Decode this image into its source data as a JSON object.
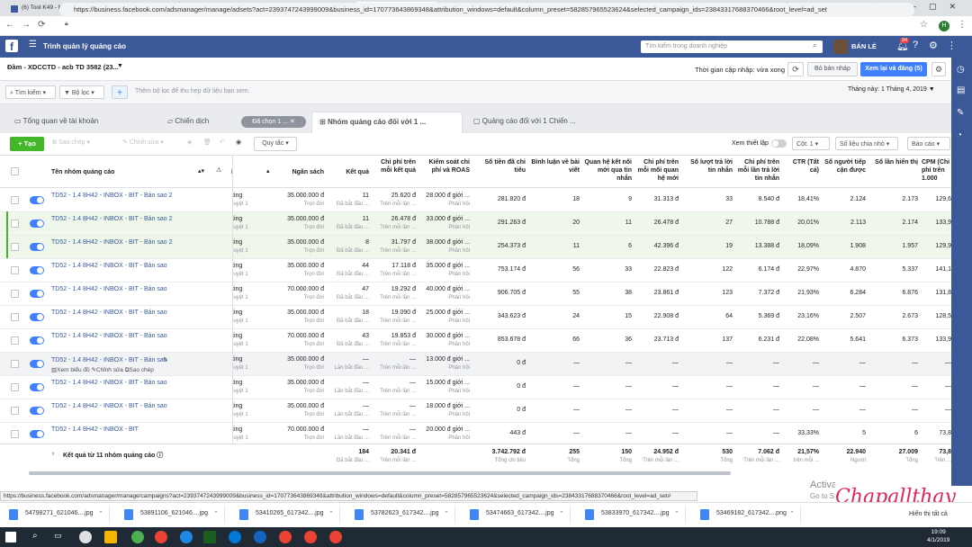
{
  "browser": {
    "tabs": [
      {
        "label": "(6) Tool K49 - Nuô",
        "icon": "facebook-icon",
        "color": "#3b5998"
      },
      {
        "label": "Video Giới thiệu cả",
        "icon": "youtube-icon",
        "color": "#ff0000"
      },
      {
        "label": "(6) Tool K49 - Nuô",
        "icon": "facebook-icon",
        "color": "#3b5998"
      },
      {
        "label": "(3) Trình quản lý q",
        "icon": "ads-manager-icon",
        "color": "#606770"
      },
      {
        "label": "(94) Trình quản lý q",
        "icon": "ads-manager-icon",
        "color": "#606770",
        "active": true
      },
      {
        "label": "ADS TỔNG - HUYỀ",
        "icon": "sheets-icon",
        "color": "#0f9d58"
      },
      {
        "label": "HDBank Internet B",
        "icon": "bank-icon",
        "color": "#f4b400"
      },
      {
        "label": "Drive của tôi - Goo",
        "icon": "drive-icon",
        "color": "#1a73e8"
      },
      {
        "label": "TMDT - BẢN SAN T",
        "icon": "sheets-icon",
        "color": "#0f9d58"
      },
      {
        "label": "Pancake v2 | Pages",
        "icon": "pancake-icon",
        "color": "#9e9e9e"
      }
    ],
    "url": "https://business.facebook.com/adsmanager/manage/adsets?act=2393747243999009&business_id=170773643869348&attribution_windows=default&column_preset=582857965523624&selected_campaign_ids=23843317688370466&root_level=ad_set",
    "profile_initial": "H",
    "status_url": "https://business.facebook.com/adsmanager/manage/campaigns?act=2393747243999009&business_id=170773643869348&attribution_windows=default&column_preset=582857965523624&selected_campaign_ids=23843317688370466&root_level=ad_set#"
  },
  "header": {
    "logo": "f",
    "title": "Trình quản lý quảng cáo",
    "search_placeholder": "Tìm kiếm trong doanh nghiệp",
    "user": "BÁN LẺ",
    "notif_count": "94"
  },
  "account": {
    "name": "Đầm - XDCCTD - acb TD 3582 (23...",
    "update_time": "Thời gian cập nhập: vừa xong",
    "draft": "Bỏ bản nháp",
    "publish": "Xem lại và đăng (5)"
  },
  "filter": {
    "search": "Tìm kiếm",
    "filter": "Bộ lọc",
    "hint": "Thêm bộ lọc để thu hẹp dữ liệu bạn xem.",
    "date_range": "Tháng này: 1 Tháng 4, 2019"
  },
  "level_tabs": {
    "overview": "Tổng quan về tài khoản",
    "campaigns": "Chiến dịch",
    "selected": "Đã chọn 1 ...",
    "adsets": "Nhóm quảng cáo đối với 1 ...",
    "ads": "Quảng cáo đối với 1 Chiến ..."
  },
  "toolbar": {
    "create": "Tạo",
    "duplicate": "Sao chép",
    "edit": "Chỉnh sửa",
    "rules": "Quy tắc",
    "view_setup": "Xem thiết lập",
    "columns": "Cột: 1",
    "breakdown": "Số liệu chia nhỏ",
    "reports": "Báo cáo"
  },
  "columns": {
    "name": "Tên nhóm quảng cáo",
    "delivery": "i",
    "budget": "Ngân sách",
    "results": "Kết quả",
    "cost_per_result": "Chi phí trên mỗi kết quả",
    "roas": "Kiểm soát chi phí và ROAS",
    "spent": "Số tiền đã chi tiêu",
    "comments": "Bình luận về bài viết",
    "messaging": "Quan hệ kết nối mới qua tin nhắn",
    "cost_messaging": "Chi phí trên mỗi mối quan hệ mới",
    "replies": "Số lượt trả lời tin nhắn",
    "cost_replies": "Chi phí trên mỗi lần trả lời tin nhắn",
    "ctr": "CTR (Tất cả)",
    "reach": "Số người tiếp cận được",
    "impressions": "Số lần hiển thị",
    "cpm": "CPM (Chi phí trên 1.000"
  },
  "rows": [
    {
      "name": "TD52 - 1.4 8H42 - INBOX - BIT - Bản sao 2",
      "delivery": "ting",
      "delivery_sub": "luyệt 1",
      "budget": "35.000.000 đ",
      "budget_sub": "Trọn đời",
      "results": "11",
      "results_sub": "Đã bắt đầu ...",
      "cpr": "25.620 đ",
      "cpr_sub": "Trên mỗi lần ...",
      "roas": "28.000 đ giới ...",
      "roas_sub": "Phân hồi",
      "spent": "281.820 đ",
      "comments": "18",
      "messaging": "9",
      "cost_msg": "31.313 đ",
      "replies": "33",
      "cost_rep": "8.540 đ",
      "ctr": "18,41%",
      "reach": "2.124",
      "impr": "2.173",
      "cpm": "129,6",
      "selected": false
    },
    {
      "name": "TD52 - 1.4 8H42 - INBOX - BIT - Bản sao 2",
      "delivery": "ting",
      "delivery_sub": "luyệt 1",
      "budget": "35.000.000 đ",
      "budget_sub": "Trọn đời",
      "results": "11",
      "results_sub": "Đã bắt đầu ...",
      "cpr": "26.478 đ",
      "cpr_sub": "Trên mỗi lần ...",
      "roas": "33.000 đ giới ...",
      "roas_sub": "Phân hồi",
      "spent": "291.263 đ",
      "comments": "20",
      "messaging": "11",
      "cost_msg": "26.478 đ",
      "replies": "27",
      "cost_rep": "10.788 đ",
      "ctr": "20,01%",
      "reach": "2.113",
      "impr": "2.174",
      "cpm": "133,9",
      "selected": true
    },
    {
      "name": "TD52 - 1.4 8H42 - INBOX - BIT - Bản sao 2",
      "delivery": "ting",
      "delivery_sub": "luyệt 1",
      "budget": "35.000.000 đ",
      "budget_sub": "Trọn đời",
      "results": "8",
      "results_sub": "Đã bắt đầu ...",
      "cpr": "31.797 đ",
      "cpr_sub": "Trên mỗi lần ...",
      "roas": "38.000 đ giới ...",
      "roas_sub": "Phân hồi",
      "spent": "254.373 đ",
      "comments": "11",
      "messaging": "6",
      "cost_msg": "42.396 đ",
      "replies": "19",
      "cost_rep": "13.388 đ",
      "ctr": "18,09%",
      "reach": "1.908",
      "impr": "1.957",
      "cpm": "129,9",
      "selected": true
    },
    {
      "name": "TD52 - 1.4 8H42 - INBOX - BIT - Bản sao",
      "delivery": "ting",
      "delivery_sub": "luyệt 1",
      "budget": "35.000.000 đ",
      "budget_sub": "Trọn đời",
      "results": "44",
      "results_sub": "Đã bắt đầu ...",
      "cpr": "17.118 đ",
      "cpr_sub": "Trên mỗi lần ...",
      "roas": "35.000 đ giới ...",
      "roas_sub": "Phân hồi",
      "spent": "753.174 đ",
      "comments": "56",
      "messaging": "33",
      "cost_msg": "22.823 đ",
      "replies": "122",
      "cost_rep": "6.174 đ",
      "ctr": "22,97%",
      "reach": "4.870",
      "impr": "5.337",
      "cpm": "141,1",
      "selected": false
    },
    {
      "name": "TD52 - 1.4 8H42 - INBOX - BIT - Bản sao",
      "delivery": "ting",
      "delivery_sub": "luyệt 1",
      "budget": "70.000.000 đ",
      "budget_sub": "Trọn đời",
      "results": "47",
      "results_sub": "Đã bắt đầu ...",
      "cpr": "19.292 đ",
      "cpr_sub": "Trên mỗi lần ...",
      "roas": "40.000 đ giới ...",
      "roas_sub": "Phân hồi",
      "spent": "906.705 đ",
      "comments": "55",
      "messaging": "38",
      "cost_msg": "23.861 đ",
      "replies": "123",
      "cost_rep": "7.372 đ",
      "ctr": "21,93%",
      "reach": "6.284",
      "impr": "6.876",
      "cpm": "131,8",
      "selected": false
    },
    {
      "name": "TD52 - 1.4 8H42 - INBOX - BIT - Bản sao",
      "delivery": "ting",
      "delivery_sub": "luyệt 1",
      "budget": "35.000.000 đ",
      "budget_sub": "Trọn đời",
      "results": "18",
      "results_sub": "Đã bắt đầu ...",
      "cpr": "19.090 đ",
      "cpr_sub": "Trên mỗi lần ...",
      "roas": "25.000 đ giới ...",
      "roas_sub": "Phân hồi",
      "spent": "343.623 đ",
      "comments": "24",
      "messaging": "15",
      "cost_msg": "22.908 đ",
      "replies": "64",
      "cost_rep": "5.369 đ",
      "ctr": "23,16%",
      "reach": "2.507",
      "impr": "2.673",
      "cpm": "128,5",
      "selected": false
    },
    {
      "name": "TD52 - 1.4 8H42 - INBOX - BIT - Bản sao",
      "delivery": "ting",
      "delivery_sub": "luyệt 1",
      "budget": "70.000.000 đ",
      "budget_sub": "Trọn đời",
      "results": "43",
      "results_sub": "Đã bắt đầu ...",
      "cpr": "19.853 đ",
      "cpr_sub": "Trên mỗi lần ...",
      "roas": "30.000 đ giới ...",
      "roas_sub": "Phân hồi",
      "spent": "853.678 đ",
      "comments": "66",
      "messaging": "36",
      "cost_msg": "23.713 đ",
      "replies": "137",
      "cost_rep": "6.231 đ",
      "ctr": "22,08%",
      "reach": "5.641",
      "impr": "6.373",
      "cpm": "133,9",
      "selected": false
    },
    {
      "name": "TD52 - 1.4 8H42 - INBOX - BIT - Bản sao",
      "delivery": "ting",
      "delivery_sub": "luyệt 1",
      "budget": "35.000.000 đ",
      "budget_sub": "Trọn đời",
      "results": "—",
      "results_sub": "Lần bắt đầu ...",
      "cpr": "—",
      "cpr_sub": "Trên mỗi lần ...",
      "roas": "13.000 đ giới ...",
      "roas_sub": "Phân hồi",
      "spent": "0 đ",
      "comments": "—",
      "messaging": "—",
      "cost_msg": "—",
      "replies": "—",
      "cost_rep": "—",
      "ctr": "—",
      "reach": "—",
      "impr": "—",
      "cpm": "—",
      "selected": false,
      "hover": true,
      "actions": [
        "Xem biểu đồ",
        "Chỉnh sửa",
        "Sao chép"
      ]
    },
    {
      "name": "TD52 - 1.4 8H42 - INBOX - BIT - Bản sao",
      "delivery": "ting",
      "delivery_sub": "luyệt 1",
      "budget": "35.000.000 đ",
      "budget_sub": "Trọn đời",
      "results": "—",
      "results_sub": "Lần bắt đầu ...",
      "cpr": "—",
      "cpr_sub": "Trên mỗi lần ...",
      "roas": "15.000 đ giới ...",
      "roas_sub": "Phân hồi",
      "spent": "0 đ",
      "comments": "—",
      "messaging": "—",
      "cost_msg": "—",
      "replies": "—",
      "cost_rep": "—",
      "ctr": "—",
      "reach": "—",
      "impr": "—",
      "cpm": "—",
      "selected": false
    },
    {
      "name": "TD52 - 1.4 8H42 - INBOX - BIT - Bản sao",
      "delivery": "ting",
      "delivery_sub": "luyệt 1",
      "budget": "35.000.000 đ",
      "budget_sub": "Trọn đời",
      "results": "—",
      "results_sub": "Lần bắt đầu ...",
      "cpr": "—",
      "cpr_sub": "Trên mỗi lần ...",
      "roas": "18.000 đ giới ...",
      "roas_sub": "Phân hồi",
      "spent": "0 đ",
      "comments": "—",
      "messaging": "—",
      "cost_msg": "—",
      "replies": "—",
      "cost_rep": "—",
      "ctr": "—",
      "reach": "—",
      "impr": "—",
      "cpm": "—",
      "selected": false
    },
    {
      "name": "TD52 - 1.4 8H42 - INBOX - BIT",
      "delivery": "ting",
      "delivery_sub": "luyệt 1",
      "budget": "70.000.000 đ",
      "budget_sub": "Trọn đời",
      "results": "—",
      "results_sub": "Lần bắt đầu ...",
      "cpr": "—",
      "cpr_sub": "Trên mỗi lần ...",
      "roas": "20.000 đ giới ...",
      "roas_sub": "Phân hồi",
      "spent": "443 đ",
      "comments": "—",
      "messaging": "—",
      "cost_msg": "—",
      "replies": "—",
      "cost_rep": "—",
      "ctr": "33,33%",
      "reach": "5",
      "impr": "6",
      "cpm": "73,8",
      "selected": false
    }
  ],
  "summary": {
    "label": "Kết quả từ 11 nhóm quảng cáo",
    "results": "184",
    "results_sub": "Đã bắt đầu ...",
    "cpr": "20.341 đ",
    "cpr_sub": "Trên mỗi lần ...",
    "spent": "3.742.792 đ",
    "spent_sub": "Tổng chi tiêu",
    "comments": "255",
    "comments_sub": "Tổng",
    "messaging": "150",
    "messaging_sub": "Tổng",
    "cost_msg": "24.952 đ",
    "cost_msg_sub": "Trên mỗi lần ...",
    "replies": "530",
    "replies_sub": "Tổng",
    "cost_rep": "7.062 đ",
    "cost_rep_sub": "Trên mỗi lần ...",
    "ctr": "21,57%",
    "ctr_sub": "trên mỗi ...",
    "reach": "22.940",
    "reach_sub": "Người",
    "impr": "27.009",
    "impr_sub": "Tổng",
    "cpm": "73,8",
    "cpm_sub": "Trên ..."
  },
  "overlay": {
    "activate": "Activa",
    "activate2": "Go to S",
    "watermark": "Chapallthay"
  },
  "downloads": {
    "items": [
      "54798271_621046....jpg",
      "53891106_621046....jpg",
      "53410265_617342....jpg",
      "53782623_617342....jpg",
      "53474663_617342....jpg",
      "53833970_617342....jpg",
      "53469182_617342....png"
    ],
    "show_all": "Hiển thị tất cả"
  },
  "taskbar": {
    "time": "19:09",
    "date": "4/1/2019"
  }
}
